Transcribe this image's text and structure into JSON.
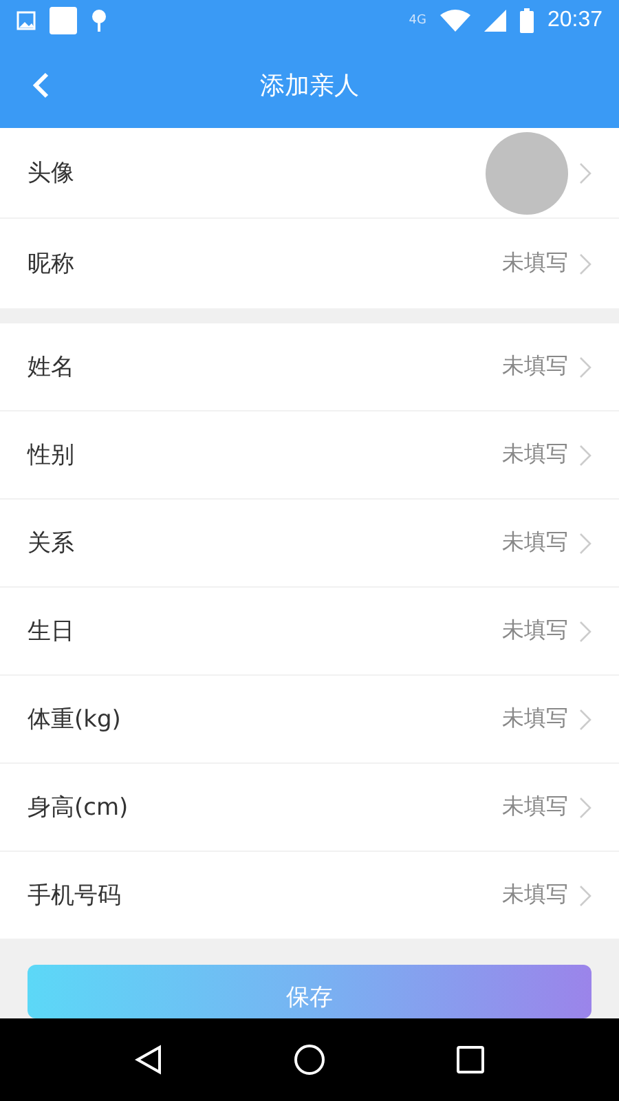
{
  "status_bar": {
    "time": "20:37",
    "network": "4G"
  },
  "app_bar": {
    "title": "添加亲人"
  },
  "sections": [
    {
      "rows": [
        {
          "kind": "avatar",
          "label": "头像"
        },
        {
          "kind": "text",
          "label": "昵称",
          "value": "未填写"
        }
      ]
    },
    {
      "rows": [
        {
          "kind": "text",
          "label": "姓名",
          "value": "未填写"
        },
        {
          "kind": "text",
          "label": "性别",
          "value": "未填写"
        },
        {
          "kind": "text",
          "label": "关系",
          "value": "未填写"
        },
        {
          "kind": "text",
          "label": "生日",
          "value": "未填写"
        },
        {
          "kind": "text",
          "label": "体重(kg)",
          "value": "未填写"
        },
        {
          "kind": "text",
          "label": "身高(cm)",
          "value": "未填写"
        },
        {
          "kind": "text",
          "label": "手机号码",
          "value": "未填写"
        }
      ]
    }
  ],
  "save_button": {
    "label": "保存"
  }
}
